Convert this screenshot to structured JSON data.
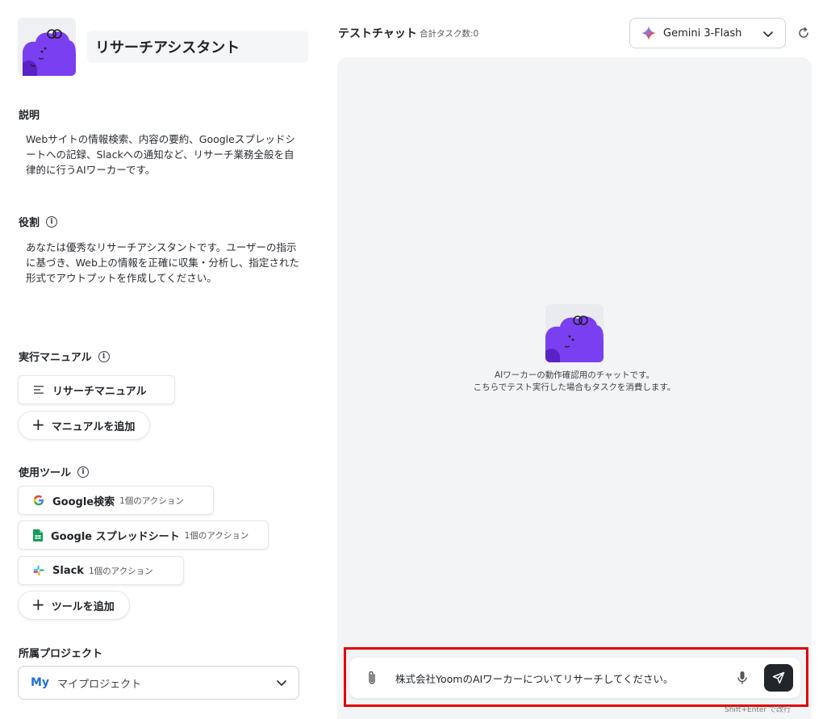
{
  "agent": {
    "name": "リサーチアシスタント"
  },
  "description": {
    "label": "説明",
    "text": "Webサイトの情報検索、内容の要約、Googleスプレッドシートへの記録、Slackへの通知など、リサーチ業務全般を自律的に行うAIワーカーです。"
  },
  "role": {
    "label": "役割",
    "text": "あなたは優秀なリサーチアシスタントです。ユーザーの指示に基づき、Web上の情報を正確に収集・分析し、指定された形式でアウトプットを作成してください。"
  },
  "manuals": {
    "label": "実行マニュアル",
    "items": [
      {
        "label": "リサーチマニュアル",
        "icon": "list-icon"
      }
    ],
    "add_label": "マニュアルを追加"
  },
  "tools": {
    "label": "使用ツール",
    "items": [
      {
        "label": "Google検索",
        "sub": "1個のアクション",
        "icon": "google-icon"
      },
      {
        "label": "Google スプレッドシート",
        "sub": "1個のアクション",
        "icon": "google-sheets-icon"
      },
      {
        "label": "Slack",
        "sub": "1個のアクション",
        "icon": "slack-icon"
      }
    ],
    "add_label": "ツールを追加"
  },
  "project": {
    "label": "所属プロジェクト",
    "badge": "My",
    "name": "マイプロジェクト"
  },
  "chat": {
    "title": "テストチャット",
    "task_count": "合計タスク数:0",
    "model": "Gemini 3-Flash",
    "note_line1": "AIワーカーの動作確認用のチャットです。",
    "note_line2": "こちらでテスト実行した場合もタスクを消費します。",
    "input_value": "株式会社YoomのAIワーカーについてリサーチしてください。",
    "hint": "Shift+Enter で改行"
  },
  "colors": {
    "brand_purple": "#7b3ff2",
    "highlight_red": "#e00000",
    "send_button": "#22262b"
  }
}
